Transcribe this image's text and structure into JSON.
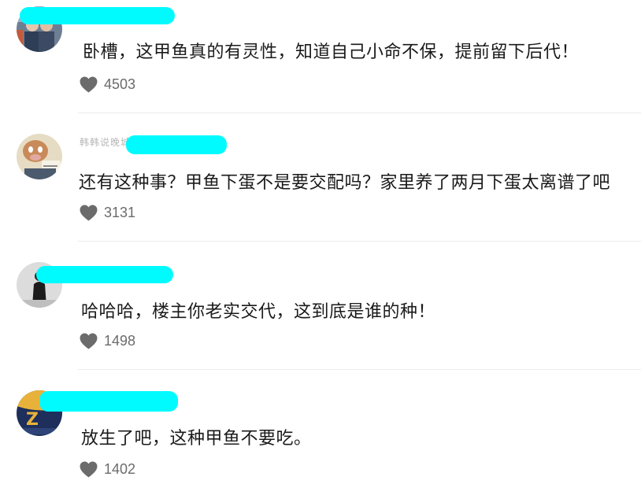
{
  "comments": [
    {
      "text": "卧槽，这甲鱼真的有灵性，知道自己小命不保，提前留下后代！",
      "likes": "4503",
      "avatar_icon": "avatar-people-photo"
    },
    {
      "username_partial": "韩韩说晚城",
      "text": "还有这种事？甲鱼下蛋不是要交配吗？家里养了两月下蛋太离谱了吧",
      "likes": "3131",
      "avatar_icon": "avatar-cartoon-cat"
    },
    {
      "text": "哈哈哈，楼主你老实交代，这到底是谁的种！",
      "likes": "1498",
      "avatar_icon": "avatar-standing-figure"
    },
    {
      "text": "放生了吧，这种甲鱼不要吃。",
      "likes": "1402",
      "avatar_icon": "avatar-jersey-number"
    }
  ],
  "colors": {
    "redaction": "#00fbff",
    "heart": "#6b6b6b",
    "text": "#1a1a1a",
    "like_count": "#6b6b6b",
    "divider": "#ececec"
  }
}
